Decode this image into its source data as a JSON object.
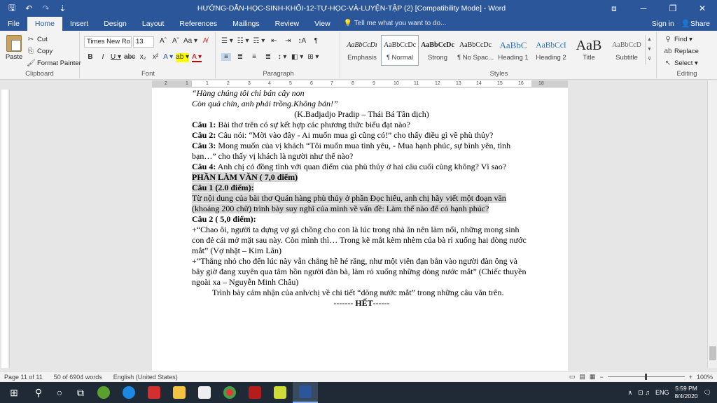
{
  "titlebar": {
    "qat_save": "🖫",
    "qat_undo": "↶",
    "qat_redo": "↷",
    "qat_more": "⇣",
    "title": "HƯỚNG-DẪN-HỌC-SINH-KHỐI-12-TỰ-HỌC-VÀ-LUYỆN-TẬP (2) [Compatibility Mode] - Word",
    "ribbon_opts": "⧈",
    "minimize": "─",
    "maximize": "❐",
    "close": "✕"
  },
  "tabs": [
    {
      "label": "File"
    },
    {
      "label": "Home"
    },
    {
      "label": "Insert"
    },
    {
      "label": "Design"
    },
    {
      "label": "Layout"
    },
    {
      "label": "References"
    },
    {
      "label": "Mailings"
    },
    {
      "label": "Review"
    },
    {
      "label": "View"
    }
  ],
  "tellme": "Tell me what you want to do...",
  "signin": "Sign in",
  "share": "Share",
  "clipboard": {
    "paste": "Paste",
    "cut": "Cut",
    "copy": "Copy",
    "format_painter": "Format Painter",
    "label": "Clipboard"
  },
  "font": {
    "name": "Times New Ro",
    "size": "13",
    "row1": [
      "Aˆ",
      "Aˇ",
      "Aa ▾",
      "A̸"
    ],
    "row2": [
      "B",
      "I",
      "U ▾",
      "abc",
      "x₂",
      "x²",
      "A ▾",
      "ab ▾",
      "A ▾"
    ],
    "label": "Font"
  },
  "paragraph": {
    "row1": [
      "☰ ▾",
      "☷ ▾",
      "☶ ▾",
      "⇤",
      "⇥",
      "↕A",
      "¶"
    ],
    "row2": [
      "≡",
      "≣",
      "≡",
      "≣",
      "↕ ▾",
      "◧ ▾",
      "⊞ ▾"
    ],
    "label": "Paragraph"
  },
  "styles": {
    "items": [
      {
        "sample": "AaBbCcDı",
        "name": "Emphasis"
      },
      {
        "sample": "AaBbCcDc",
        "name": "¶ Normal"
      },
      {
        "sample": "AaBbCcDc",
        "name": "Strong"
      },
      {
        "sample": "AaBbCcDc",
        "name": "¶ No Spac..."
      },
      {
        "sample": "AaBbC",
        "name": "Heading 1"
      },
      {
        "sample": "AaBbCcI",
        "name": "Heading 2"
      },
      {
        "sample": "AaB",
        "name": "Title"
      },
      {
        "sample": "AaBbCcD",
        "name": "Subtitle"
      }
    ],
    "label": "Styles"
  },
  "editing": {
    "find": "Find ▾",
    "replace": "Replace",
    "select": "Select ▾",
    "label": "Editing"
  },
  "document": {
    "lines": {
      "l1": "“Hàng chúng tôi chỉ bán cây non",
      "l2": "Còn quả chín, anh phải trồng.Không bán!”",
      "l3": "(K.Badjadjo Pradip – Thái Bá Tân dịch)",
      "q1_label": "Câu 1:",
      "q1_text": " Bài thơ trên có sự kết hợp các phương thức biểu đạt nào?",
      "q2_label": "Câu 2:",
      "q2_text": " Câu nói: “Mời vào đây - Ai muốn mua gì cũng có!” cho thấy điều gì về phù thủy?",
      "q3_label": "Câu 3:",
      "q3_text": " Mong muốn của vị khách “Tôi muốn mua tình yêu, - Mua hạnh phúc, sự bình yên, tình bạn…” cho thấy vị khách là người như thế nào?",
      "q4_label": "Câu 4:",
      "q4_text": " Anh chị có đồng tình với quan điểm của phù thủy ở hai câu cuối cùng không? Vì sao?",
      "part_heading": "PHẦN LÀM VĂN ( 7,0 điểm)",
      "c1_heading": "Câu 1 (2.0 điểm):",
      "c1_text": "Từ nội dung của bài thơ Quán hàng phù thủy ở phần Đọc hiểu, anh chị hãy viết một đoạn văn (khoảng 200 chữ) trình bày suy nghĩ của mình về vấn đề: Làm thế nào để có hạnh phúc?",
      "c2_heading": "Câu 2 ( 5,0 điểm):",
      "quote1": "+“Chao ôi, người ta dựng vợ gả chồng cho con là lúc trong nhà ăn nên làm nổi, những mong sinh con đẻ cái mở mặt sau này. Còn mình thì… Trong kẽ mắt kèm nhèm của bà rỉ xuống hai dòng nước mắt” (Vợ nhặt – Kim Lân)",
      "quote2": "+“Thằng nhỏ cho đến lúc này vẫn chẳng hề hé răng, như một viên đạn bắn vào người đàn ông và bây giờ đang xuyên qua tâm hồn người đàn bà, làm rỏ xuống những dòng nước mắt” (Chiếc thuyền ngoài xa – Nguyễn Minh Châu)",
      "task": "Trình bày cảm nhận của anh/chị về chi tiết “dòng nước mắt” trong những câu văn trên.",
      "end_dash1": "------- ",
      "end_word": "HẾT",
      "end_dash2": "------"
    }
  },
  "ruler": {
    "numbers": [
      "2",
      "1",
      "1",
      "2",
      "3",
      "4",
      "5",
      "6",
      "7",
      "8",
      "9",
      "10",
      "11",
      "12",
      "13",
      "14",
      "15",
      "16",
      "18"
    ]
  },
  "statusbar": {
    "page": "Page 11 of 11",
    "words": "50 of 6904 words",
    "language": "English (United States)",
    "zoom_minus": "−",
    "zoom_plus": "+",
    "zoom": "100%"
  },
  "taskbar": {
    "start": "⊞",
    "search": "⚲",
    "cortana": "○",
    "taskview": "⧉",
    "tray_up": "∧",
    "tray_icons": "⊡ ♫",
    "lang": "ENG",
    "time": "5:59 PM",
    "date": "8/4/2020",
    "notif": "🗨"
  }
}
